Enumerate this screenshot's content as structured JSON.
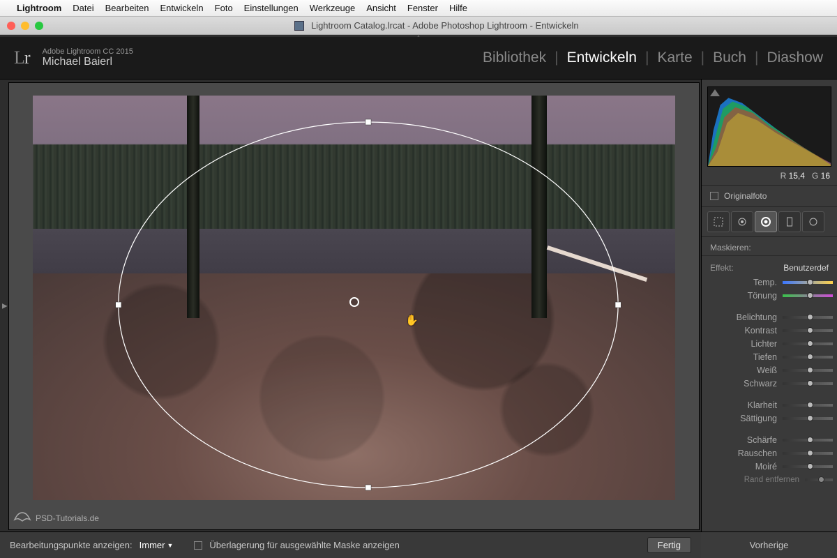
{
  "menubar": {
    "app": "Lightroom",
    "items": [
      "Datei",
      "Bearbeiten",
      "Entwickeln",
      "Foto",
      "Einstellungen",
      "Werkzeuge",
      "Ansicht",
      "Fenster",
      "Hilfe"
    ]
  },
  "window": {
    "title": "Lightroom Catalog.lrcat - Adobe Photoshop Lightroom - Entwickeln"
  },
  "header": {
    "product": "Adobe Lightroom CC 2015",
    "user": "Michael Baierl",
    "modules": [
      "Bibliothek",
      "Entwickeln",
      "Karte",
      "Buch",
      "Diashow"
    ],
    "active_module": "Entwickeln"
  },
  "panel": {
    "readout": {
      "r_label": "R",
      "r_value": "15,4",
      "g_label": "G",
      "g_value": "16"
    },
    "original_label": "Originalfoto",
    "mask_label": "Maskieren:",
    "effekt_label": "Effekt:",
    "effekt_value": "Benutzerdef",
    "sliders_a": [
      "Temp.",
      "Tönung"
    ],
    "sliders_b": [
      "Belichtung",
      "Kontrast",
      "Lichter",
      "Tiefen",
      "Weiß",
      "Schwarz"
    ],
    "sliders_c": [
      "Klarheit",
      "Sättigung"
    ],
    "sliders_d": [
      "Schärfe",
      "Rauschen",
      "Moiré"
    ],
    "sliders_e": [
      "Rand entfernen"
    ]
  },
  "tools": [
    "crop",
    "spot",
    "radial",
    "rect",
    "brush"
  ],
  "strip": {
    "pins_label": "Bearbeitungspunkte anzeigen:",
    "pins_value": "Immer",
    "overlay_label": "Überlagerung für ausgewählte Maske anzeigen",
    "done": "Fertig"
  },
  "right_strip": {
    "prev": "Vorherige"
  },
  "watermark": "PSD-Tutorials.de"
}
